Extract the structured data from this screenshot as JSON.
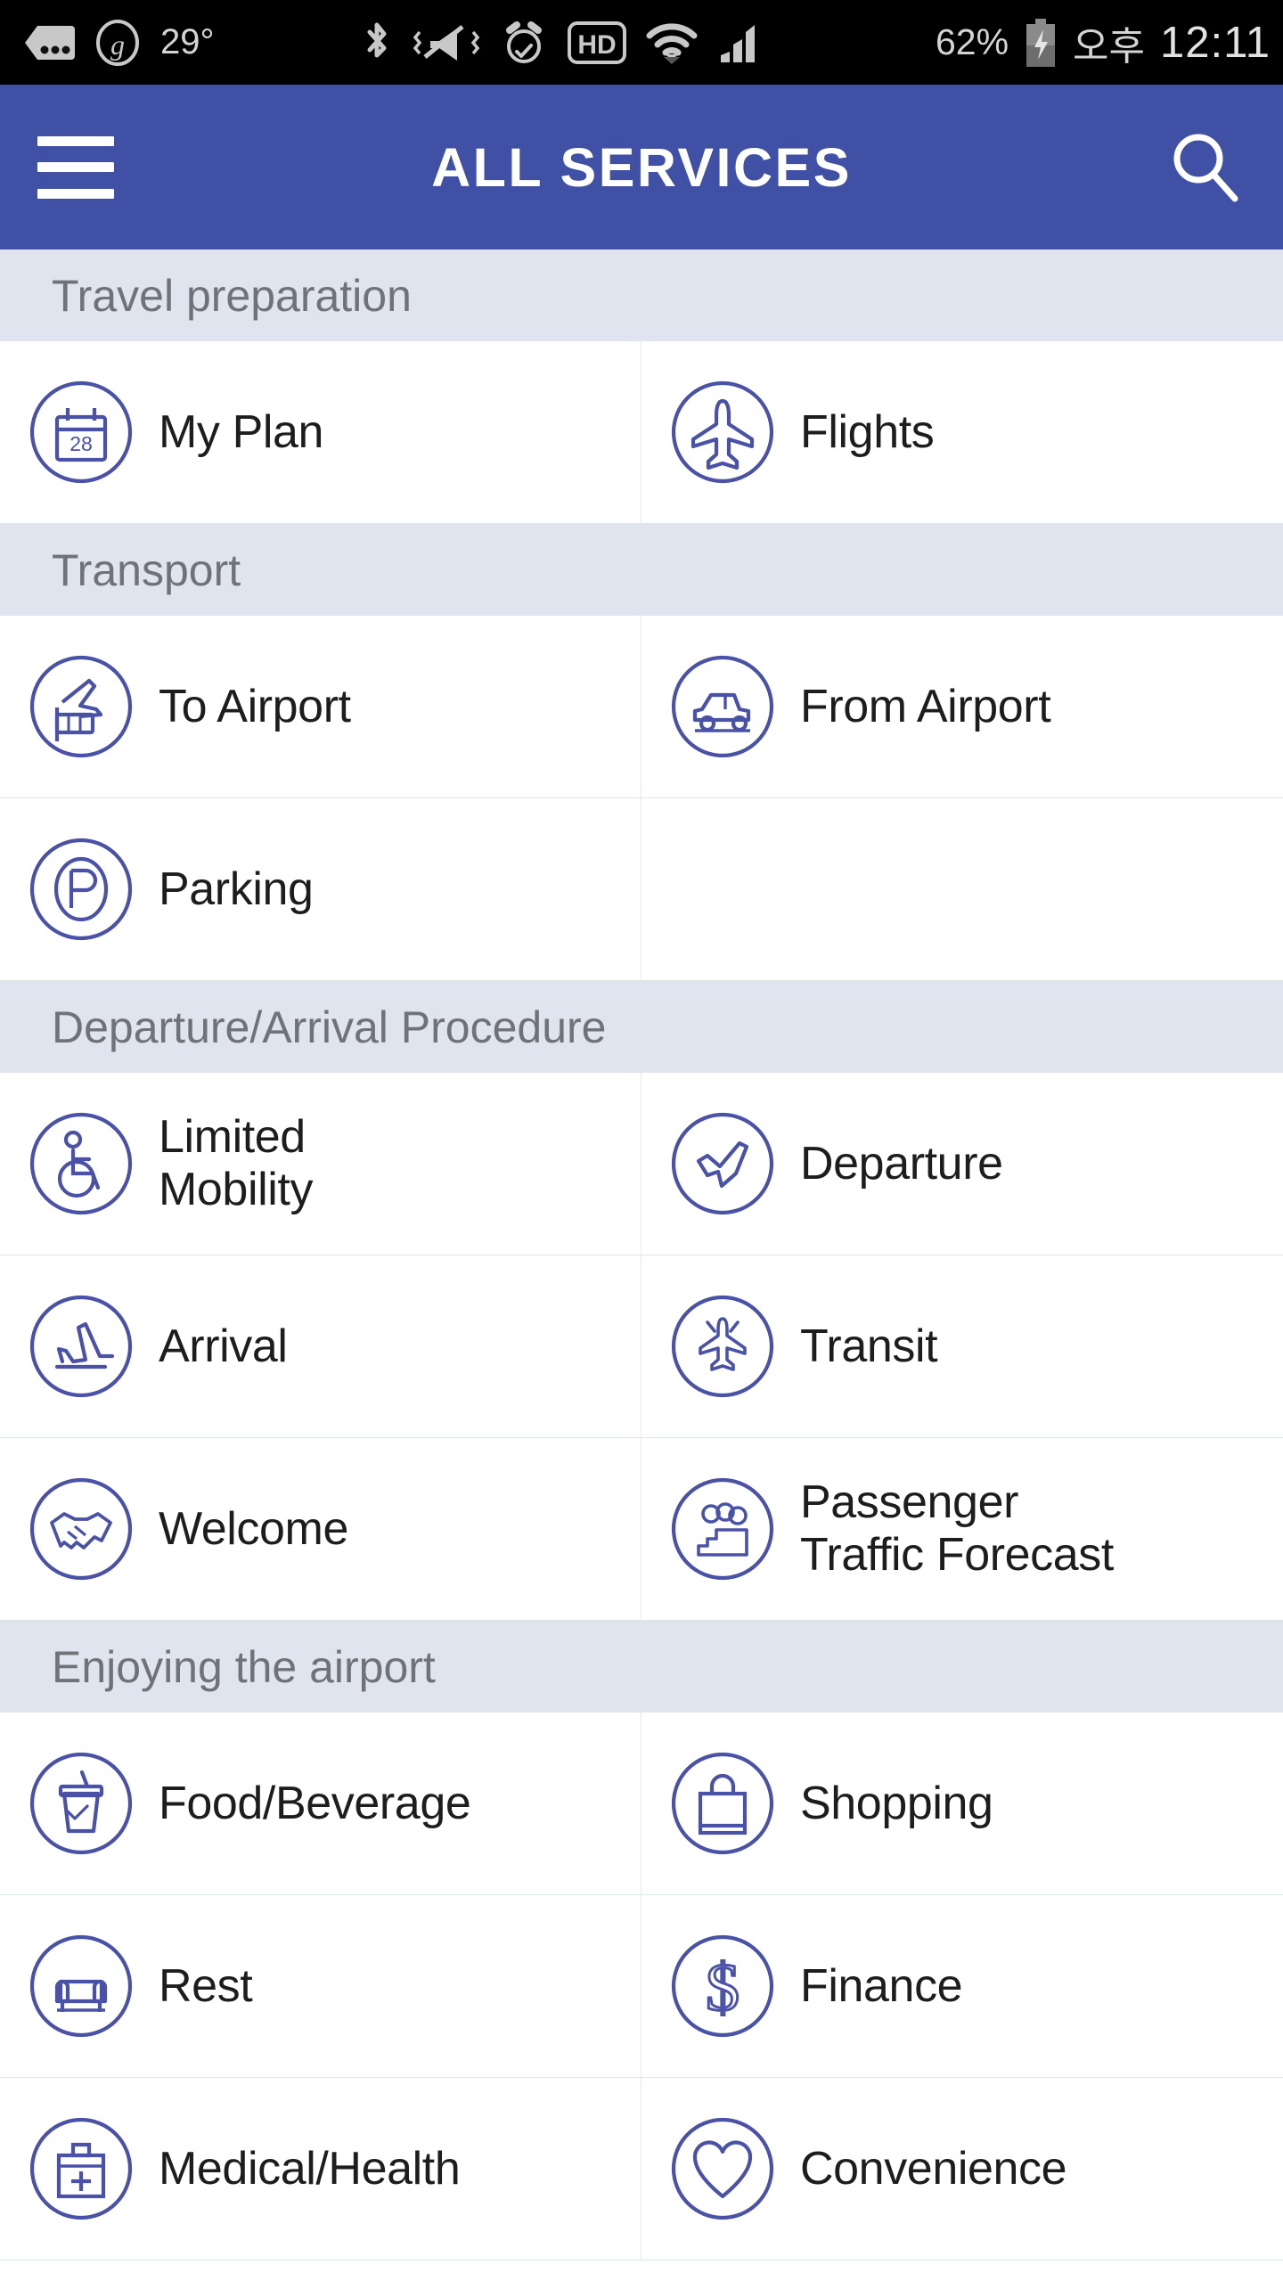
{
  "status_bar": {
    "icons_left": [
      "more-dots-icon",
      "g-circle-icon"
    ],
    "temperature": "29°",
    "icons_right": [
      "bluetooth-icon",
      "vibrate-mute-icon",
      "alarm-icon",
      "hd-icon",
      "wifi-icon",
      "signal-icon"
    ],
    "battery_percent": "62%",
    "battery_icon": "battery-charging-icon",
    "am_pm": "오후",
    "time": "12:11"
  },
  "appbar": {
    "menu_icon": "hamburger-menu-icon",
    "title": "ALL SERVICES",
    "search_icon": "search-icon"
  },
  "colors": {
    "appbar_bg": "#4050A4",
    "section_header_bg": "#E0E4EF",
    "icon_stroke": "#4A52A8",
    "section_label": "#6F7278",
    "item_label": "#1D1D1D",
    "status_bar_bg": "#000000",
    "divider": "#DFE6E6"
  },
  "sections": [
    {
      "title": "Travel preparation",
      "rows": [
        [
          {
            "label": "My Plan",
            "icon": "calendar-icon",
            "badge": "28"
          },
          {
            "label": "Flights",
            "icon": "airplane-icon"
          }
        ]
      ]
    },
    {
      "title": "Transport",
      "rows": [
        [
          {
            "label": "To Airport",
            "icon": "to-airport-icon"
          },
          {
            "label": "From Airport",
            "icon": "car-icon"
          }
        ],
        [
          {
            "label": "Parking",
            "icon": "parking-p-icon"
          },
          {
            "label": "",
            "icon": ""
          }
        ]
      ]
    },
    {
      "title": "Departure/Arrival Procedure",
      "rows": [
        [
          {
            "label": "Limited Mobility",
            "icon": "wheelchair-icon"
          },
          {
            "label": "Departure",
            "icon": "plane-departure-icon"
          }
        ],
        [
          {
            "label": "Arrival",
            "icon": "plane-arrival-icon"
          },
          {
            "label": "Transit",
            "icon": "transit-planes-icon"
          }
        ],
        [
          {
            "label": "Welcome",
            "icon": "handshake-icon"
          },
          {
            "label": "Passenger Traffic Forecast",
            "icon": "people-group-icon"
          }
        ]
      ]
    },
    {
      "title": "Enjoying the airport",
      "rows": [
        [
          {
            "label": "Food/Beverage",
            "icon": "drink-cup-icon"
          },
          {
            "label": "Shopping",
            "icon": "shopping-bag-icon"
          }
        ],
        [
          {
            "label": "Rest",
            "icon": "armchair-icon"
          },
          {
            "label": "Finance",
            "icon": "dollar-sign-icon"
          }
        ],
        [
          {
            "label": "Medical/Health",
            "icon": "first-aid-kit-icon"
          },
          {
            "label": "Convenience",
            "icon": "heart-icon"
          }
        ]
      ]
    }
  ]
}
